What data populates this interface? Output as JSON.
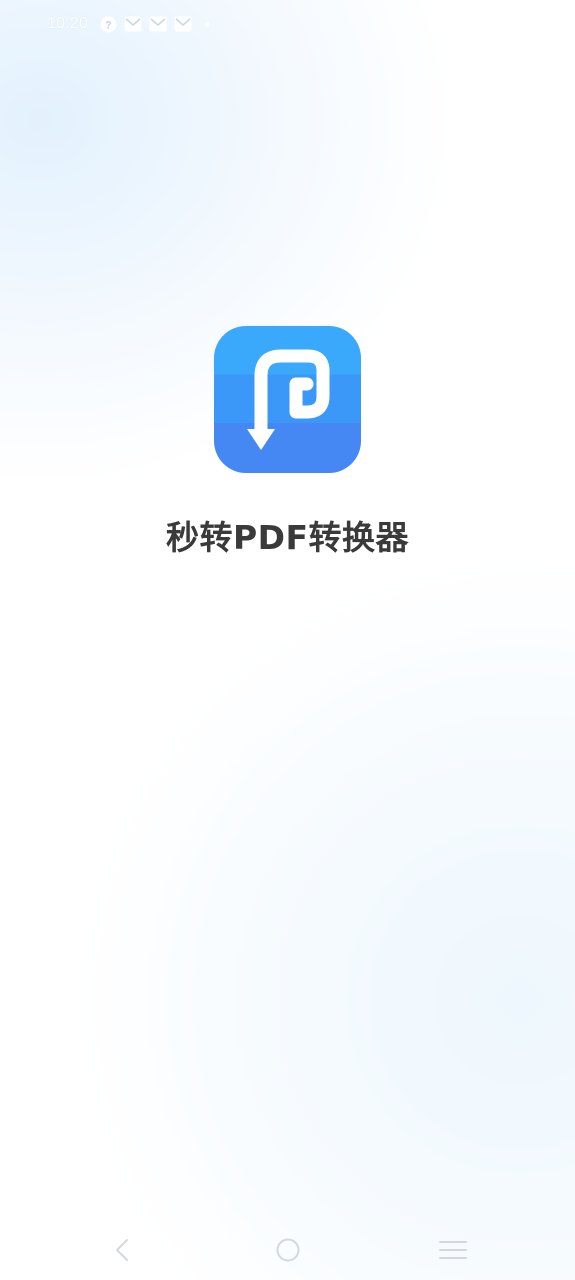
{
  "status_bar": {
    "time": "10:20",
    "icons": [
      "help-circle-icon",
      "mail-icon",
      "mail-icon",
      "mail-icon",
      "dot-icon"
    ]
  },
  "splash": {
    "app_name": "秒转PDF转换器",
    "logo_icon": "pdf-arrow-logo-icon",
    "logo_colors": [
      "#3aa8fb",
      "#3b98f8",
      "#4688f3"
    ]
  },
  "nav_bar": {
    "buttons": [
      "back-icon",
      "home-icon",
      "recent-apps-icon"
    ]
  }
}
